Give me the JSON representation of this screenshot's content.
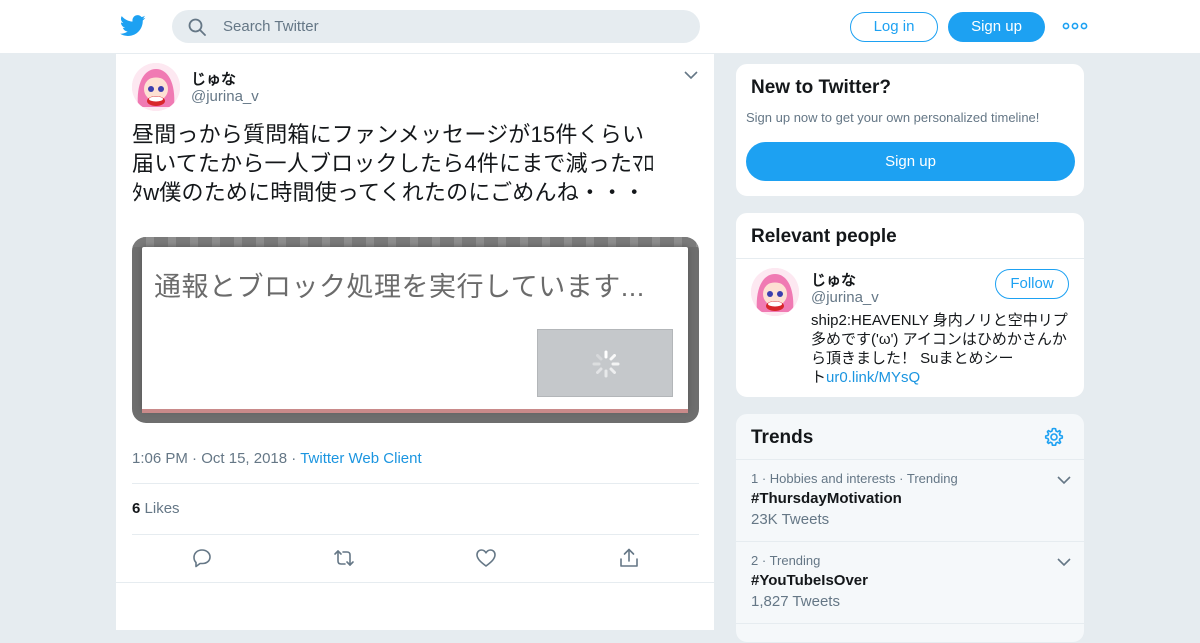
{
  "header": {
    "search_placeholder": "Search Twitter",
    "login_label": "Log in",
    "signup_label": "Sign up"
  },
  "tweet": {
    "display_name": "じゅな",
    "handle": "@jurina_v",
    "text_lines": [
      "昼間っから質問箱にファンメッセージが15件くらい",
      "届いてたから一人ブロックしたら4件にまで減ったﾏﾛ",
      "ﾀw僕のために時間使ってくれたのにごめんね・・・"
    ],
    "image_text": "通報とブロック処理を実行しています...",
    "time": "1:06 PM",
    "date": "Oct 15, 2018",
    "client": "Twitter Web Client",
    "likes_count": "6",
    "likes_label": "Likes"
  },
  "sidebar": {
    "new_to_twitter": {
      "title": "New to Twitter?",
      "subtitle": "Sign up now to get your own personalized timeline!",
      "button": "Sign up"
    },
    "relevant_people": {
      "title": "Relevant people",
      "name": "じゅな",
      "handle": "@jurina_v",
      "follow_label": "Follow",
      "bio_lines": [
        "ship2:HEAVENLY 身内ノリと空中リプ",
        "多めです('ω') アイコンはひめかさんか",
        "ら頂きました！ Suまとめシー"
      ],
      "bio_last_prefix": "ト",
      "bio_link": "ur0.link/MYsQ"
    },
    "trends": {
      "title": "Trends",
      "items": [
        {
          "rank": "1",
          "context": "Hobbies and interests · Trending",
          "tag": "#ThursdayMotivation",
          "count": "23K Tweets"
        },
        {
          "rank": "2",
          "context": "Trending",
          "tag": "#YouTubeIsOver",
          "count": "1,827 Tweets"
        }
      ]
    }
  },
  "colors": {
    "accent": "#1da1f2",
    "link": "#1b95e0",
    "background": "#e6ecf0",
    "secondary_text": "#657786"
  }
}
